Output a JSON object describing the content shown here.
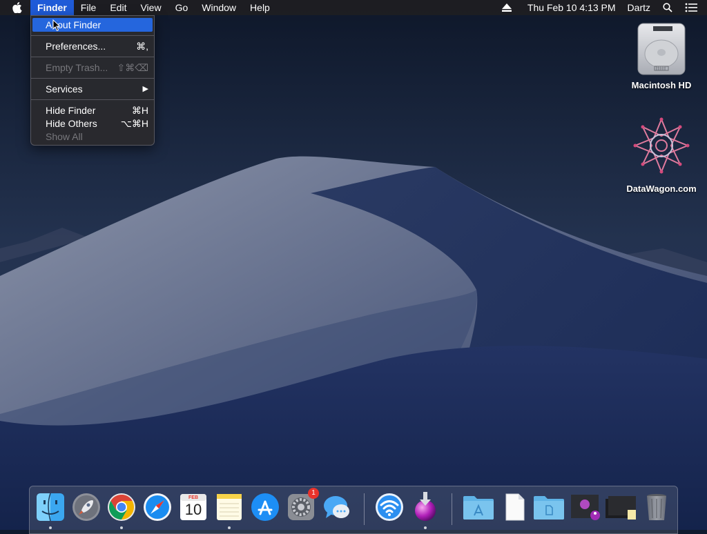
{
  "menubar": {
    "items": [
      "Finder",
      "File",
      "Edit",
      "View",
      "Go",
      "Window",
      "Help"
    ],
    "clock": "Thu Feb 10  4:13 PM",
    "user": "Dartz"
  },
  "finder_menu": {
    "items": [
      {
        "label": "About Finder",
        "shortcut": ""
      },
      {
        "label": "Preferences...",
        "shortcut": "⌘,"
      },
      {
        "label": "Empty Trash...",
        "shortcut": "⇧⌘⌫"
      },
      {
        "label": "Services",
        "shortcut": "▶"
      },
      {
        "label": "Hide Finder",
        "shortcut": "⌘H"
      },
      {
        "label": "Hide Others",
        "shortcut": "⌥⌘H"
      },
      {
        "label": "Show All",
        "shortcut": ""
      }
    ]
  },
  "desktop": {
    "icons": [
      {
        "label": "Macintosh HD"
      },
      {
        "label": "DataWagon.com"
      }
    ]
  },
  "dock": {
    "calendar_month": "FEB",
    "calendar_day": "10",
    "settings_badge": "1"
  },
  "colors": {
    "menu_highlight": "#2566dd",
    "badge": "#e8322b"
  }
}
